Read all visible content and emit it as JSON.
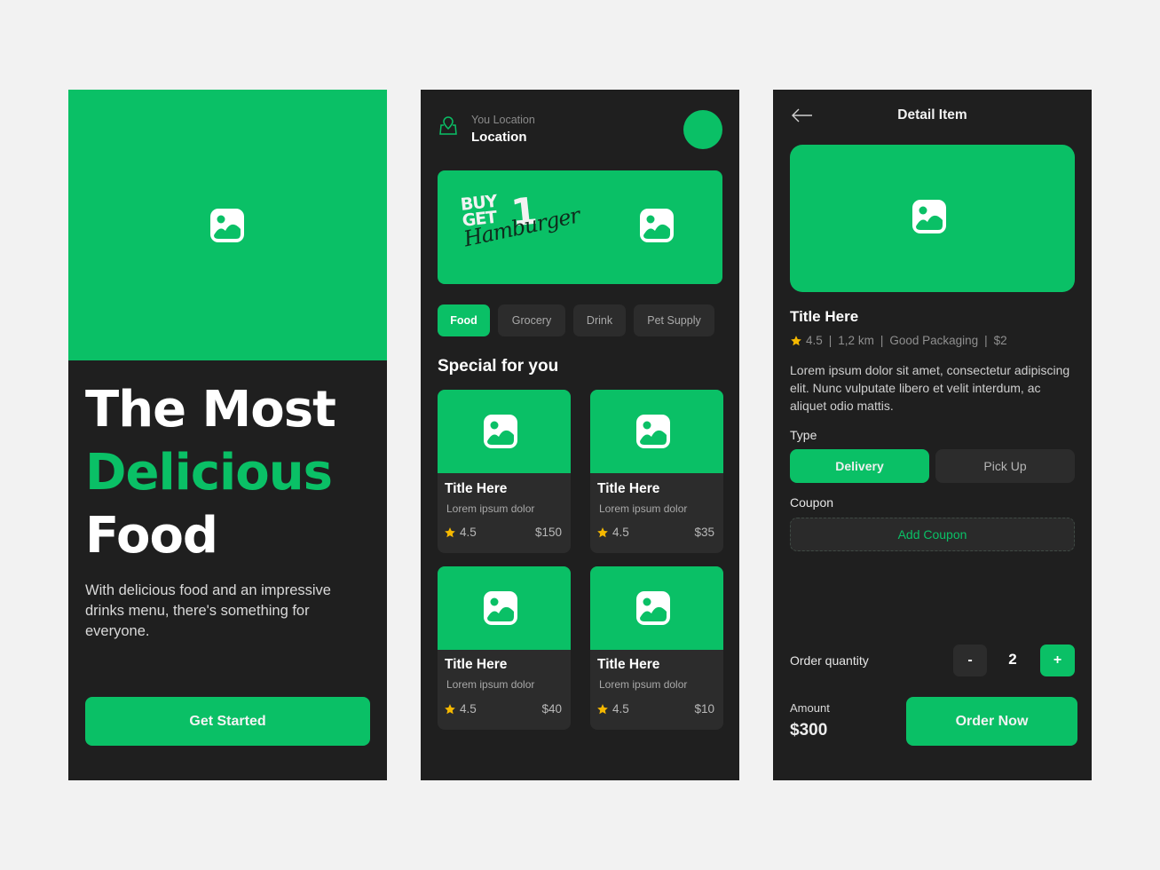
{
  "theme": {
    "accent": "#0ac066",
    "background": "#1f1f1f",
    "surface": "#2c2c2c",
    "star": "#f5b800"
  },
  "onboarding": {
    "hero_icon": "image-placeholder-icon",
    "title_line1": "The Most",
    "title_line2": "Delicious",
    "title_line3": "Food",
    "description": "With delicious food and an impressive drinks menu, there's something for everyone.",
    "cta_label": "Get Started"
  },
  "home": {
    "location_icon": "location-pin-icon",
    "location_caption": "You Location",
    "location_value": "Location",
    "promo": {
      "line1": "BUY",
      "line2": "GET",
      "number": "1",
      "script": "Hamburger"
    },
    "categories": [
      {
        "label": "Food",
        "active": true
      },
      {
        "label": "Grocery",
        "active": false
      },
      {
        "label": "Drink",
        "active": false
      },
      {
        "label": "Pet Supply",
        "active": false
      }
    ],
    "section_title": "Special for you",
    "items": [
      {
        "title": "Title Here",
        "subtitle": "Lorem ipsum dolor",
        "rating": "4.5",
        "price": "$150"
      },
      {
        "title": "Title Here",
        "subtitle": "Lorem ipsum dolor",
        "rating": "4.5",
        "price": "$35"
      },
      {
        "title": "Title Here",
        "subtitle": "Lorem ipsum dolor",
        "rating": "4.5",
        "price": "$40"
      },
      {
        "title": "Title Here",
        "subtitle": "Lorem ipsum dolor",
        "rating": "4.5",
        "price": "$10"
      }
    ]
  },
  "detail": {
    "header_title": "Detail Item",
    "item_title": "Title Here",
    "meta": {
      "rating": "4.5",
      "distance": "1,2 km",
      "tag": "Good Packaging",
      "fee": "$2",
      "separator": "|"
    },
    "description": "Lorem ipsum dolor sit amet, consectetur adipiscing elit. Nunc vulputate libero et velit interdum, ac aliquet odio mattis.",
    "type_label": "Type",
    "type_options": [
      {
        "label": "Delivery",
        "selected": true
      },
      {
        "label": "Pick Up",
        "selected": false
      }
    ],
    "coupon_label": "Coupon",
    "coupon_button": "Add Coupon",
    "quantity_label": "Order quantity",
    "quantity_minus": "-",
    "quantity_value": "2",
    "quantity_plus": "+",
    "amount_label": "Amount",
    "amount_value": "$300",
    "order_button": "Order Now"
  }
}
